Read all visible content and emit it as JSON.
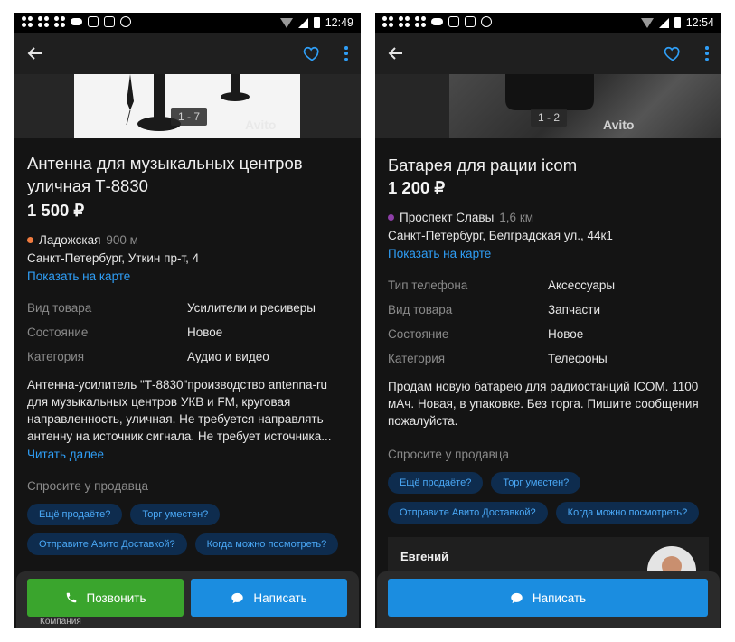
{
  "status_bar": {
    "left": {
      "time": "12:49"
    },
    "right": {
      "time": "12:54"
    }
  },
  "listing_left": {
    "photo_counter": "1 - 7",
    "watermark": "Avito",
    "title": "Антенна для музыкальных центров уличная Т-8830",
    "price": "1 500 ₽",
    "metro": {
      "name": "Ладожская",
      "distance": "900 м",
      "color": "#f07b3f"
    },
    "address": "Санкт-Петербург, Уткин пр-т, 4",
    "map_link": "Показать на карте",
    "params": [
      {
        "key": "Вид товара",
        "value": "Усилители и ресиверы"
      },
      {
        "key": "Состояние",
        "value": "Новое"
      },
      {
        "key": "Категория",
        "value": "Аудио и видео"
      }
    ],
    "description": "Антенна-усилитель \"Т-8830\"производство antenna-ru для музыкальных центров УКВ и FM, круговая направленность, уличная. Не требуется направлять антенну на источник сигнала. Не требует источника...",
    "read_more": "Читать далее",
    "ask_title": "Спросите у продавца",
    "chips": [
      "Ещё продаёте?",
      "Торг уместен?",
      "Отправите Авито Доставкой?",
      "Когда можно посмотреть?"
    ],
    "call_button": "Позвонить",
    "write_button": "Написать",
    "company_label": "Компания"
  },
  "listing_right": {
    "photo_counter": "1 - 2",
    "watermark": "Avito",
    "title": "Батарея для рации icom",
    "price": "1 200 ₽",
    "metro": {
      "name": "Проспект Славы",
      "distance": "1,6 км",
      "color": "#8e3fa8"
    },
    "address": "Санкт-Петербург, Белградская ул., 44к1",
    "map_link": "Показать на карте",
    "params": [
      {
        "key": "Тип телефона",
        "value": "Аксессуары"
      },
      {
        "key": "Вид товара",
        "value": "Запчасти"
      },
      {
        "key": "Состояние",
        "value": "Новое"
      },
      {
        "key": "Категория",
        "value": "Телефоны"
      }
    ],
    "description": "Продам новую батарею для радиостанций  ICOM. 1100 мАч. Новая, в упаковке. Без торга. Пишите сообщения пожалуйста.",
    "ask_title": "Спросите у продавца",
    "chips": [
      "Ещё продаёте?",
      "Торг уместен?",
      "Отправите Авито Доставкой?",
      "Когда можно посмотреть?"
    ],
    "seller_name": "Евгений",
    "write_button": "Написать"
  },
  "colors": {
    "accent": "#2f9ef6",
    "call_green": "#3aa52d",
    "write_blue": "#1b8de0",
    "background": "#141414"
  }
}
